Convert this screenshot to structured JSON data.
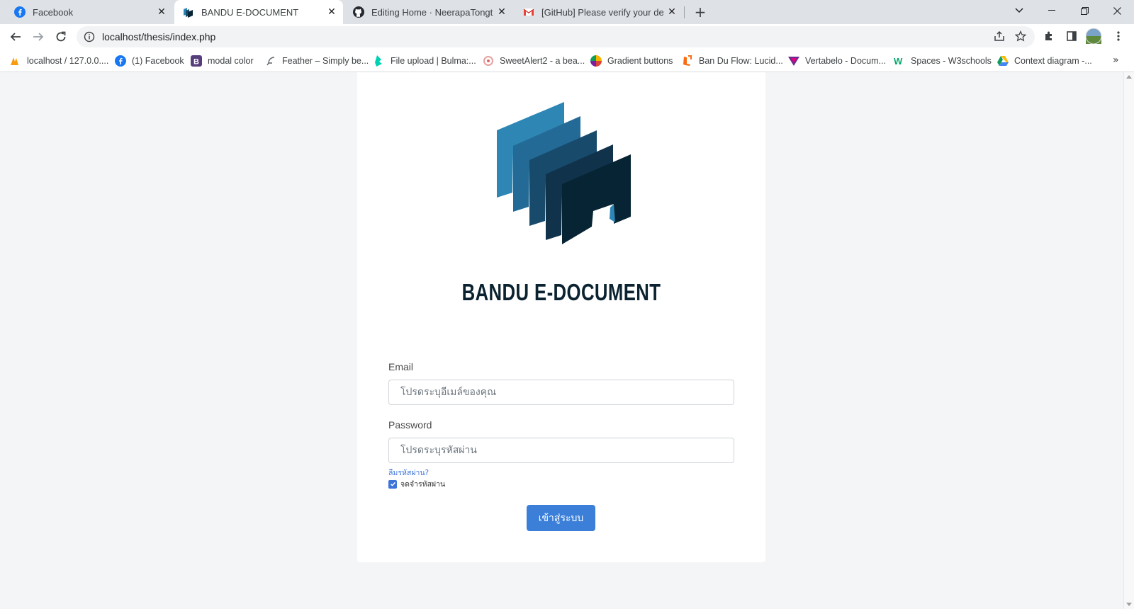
{
  "browser": {
    "tabs": [
      {
        "title": "Facebook",
        "icon": "facebook-icon",
        "active": false
      },
      {
        "title": "BANDU E-DOCUMENT",
        "icon": "bandu-logo-icon",
        "active": true
      },
      {
        "title": "Editing Home · NeerapaTongtitra",
        "icon": "github-icon",
        "active": false
      },
      {
        "title": "[GitHub] Please verify your device",
        "icon": "gmail-icon",
        "active": false
      }
    ],
    "url": "localhost/thesis/index.php",
    "bookmarks": [
      {
        "label": "localhost / 127.0.0....",
        "icon": "phpmyadmin-icon"
      },
      {
        "label": "(1) Facebook",
        "icon": "facebook-icon"
      },
      {
        "label": "modal color",
        "icon": "bootstrap-icon"
      },
      {
        "label": "Feather – Simply be...",
        "icon": "feather-icon"
      },
      {
        "label": "File upload | Bulma:...",
        "icon": "bulma-icon"
      },
      {
        "label": "SweetAlert2 - a bea...",
        "icon": "sweetalert-icon"
      },
      {
        "label": "Gradient buttons",
        "icon": "gradient-icon"
      },
      {
        "label": "Ban Du Flow: Lucid...",
        "icon": "lucid-icon"
      },
      {
        "label": "Vertabelo - Docum...",
        "icon": "vertabelo-icon"
      },
      {
        "label": "Spaces - W3schools",
        "icon": "w3schools-icon"
      },
      {
        "label": "Context diagram -...",
        "icon": "google-drive-icon"
      }
    ],
    "colors": {
      "tabstrip": "#dee1e6",
      "accent": "#3b7fd9"
    }
  },
  "page": {
    "brand_title": "BANDU E-DOCUMENT",
    "email": {
      "label": "Email",
      "placeholder": "โปรดระบุอีเมล์ของคุณ"
    },
    "password": {
      "label": "Password",
      "placeholder": "โปรดระบุรหัสผ่าน"
    },
    "forgot_password": "ลืมรหัสผ่าน?",
    "remember_me": {
      "label": "จดจำรหัสผ่าน",
      "checked": true
    },
    "login_button": "เข้าสู่ระบบ",
    "colors": {
      "title": "#0b2230",
      "logo": [
        "#2e86b5",
        "#236b96",
        "#174a6b",
        "#10324a",
        "#062433"
      ]
    }
  }
}
